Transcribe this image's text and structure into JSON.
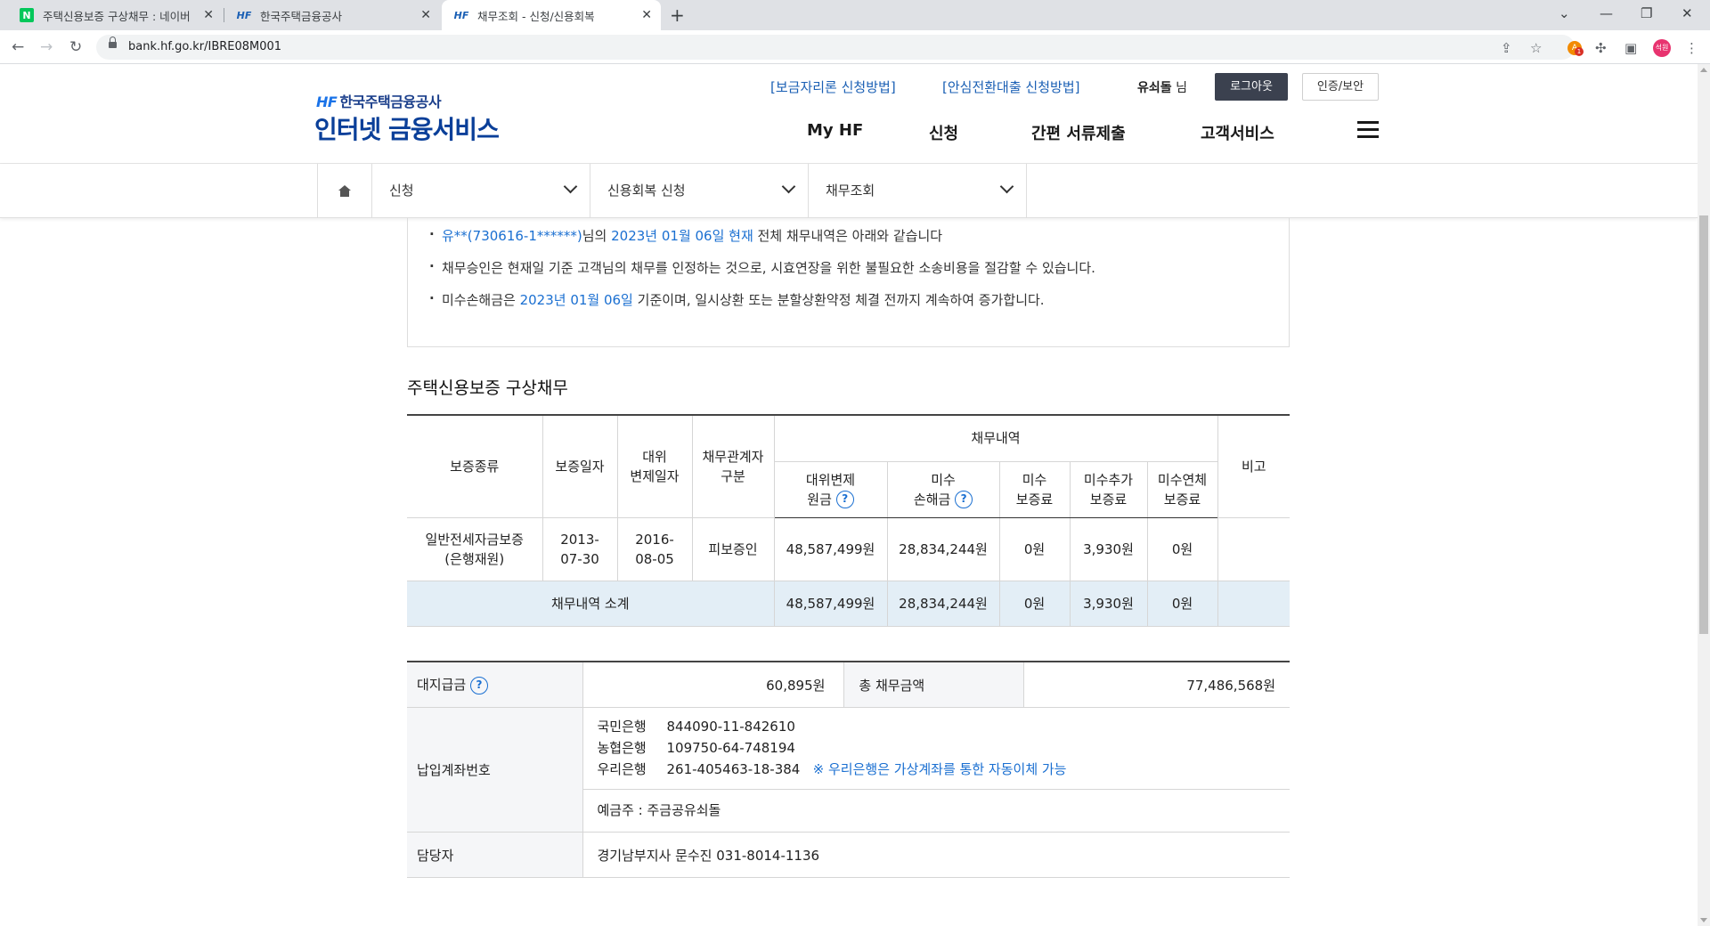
{
  "browser": {
    "tabs": [
      {
        "title": "주택신용보증 구상채무 : 네이버",
        "favicon": "naver-icon"
      },
      {
        "title": "한국주택금융공사",
        "favicon": "hf-icon"
      },
      {
        "title": "채무조회 - 신청/신용회복",
        "favicon": "hf-icon",
        "active": true
      }
    ],
    "url": "bank.hf.go.kr/IBRE08M001",
    "profile_initials": "석원",
    "extension_badge_count": "1"
  },
  "header": {
    "logo_small": "한국주택금융공사",
    "logo_hf": "HF",
    "logo_main": "인터넷 금융서비스",
    "top_links": [
      "[보금자리론 신청방법]",
      "[안심전환대출 신청방법]"
    ],
    "user_name": "유쇠돌",
    "user_suffix": "님",
    "logout_label": "로그아웃",
    "cert_label": "인증/보안",
    "gnb": [
      "My HF",
      "신청",
      "간편 서류제출",
      "고객서비스"
    ]
  },
  "breadcrumb": {
    "items": [
      "신청",
      "신용회복 신청",
      "채무조회"
    ]
  },
  "notice": {
    "line1": {
      "name": "유**(730616-1******)",
      "mid": "님의 ",
      "date": "2023년 01월 06일 현재",
      "rest": " 전체 채무내역은 아래와 같습니다"
    },
    "line2": "채무승인은 현재일 기준 고객님의 채무를 인정하는 것으로, 시효연장을 위한 불필요한 소송비용을 절감할 수 있습니다.",
    "line3": {
      "pre": "미수손해금은 ",
      "date": "2023년 01월 06일",
      "rest": " 기준이며, 일시상환 또는 분할상환약정 체결 전까지 계속하여 증가합니다."
    }
  },
  "section_title": "주택신용보증 구상채무",
  "debt_table": {
    "headers": {
      "type": "보증종류",
      "guarantee_date": "보증일자",
      "sub_date_1": "대위",
      "sub_date_2": "변제일자",
      "relation_1": "채무관계자",
      "relation_2": "구분",
      "group": "채무내역",
      "principal_1": "대위변제",
      "principal_2": "원금",
      "damages_1": "미수",
      "damages_2": "손해금",
      "fee_1": "미수",
      "fee_2": "보증료",
      "addfee_1": "미수추가",
      "addfee_2": "보증료",
      "latefee_1": "미수연체",
      "latefee_2": "보증료",
      "note": "비고"
    },
    "row": {
      "type_1": "일반전세자금보증",
      "type_2": "(은행재원)",
      "guarantee_date_1": "2013-",
      "guarantee_date_2": "07-30",
      "sub_date_1": "2016-",
      "sub_date_2": "08-05",
      "relation": "피보증인",
      "principal": "48,587,499원",
      "damages": "28,834,244원",
      "fee": "0원",
      "addfee": "3,930원",
      "latefee": "0원",
      "note": ""
    },
    "subtotal": {
      "label": "채무내역 소계",
      "principal": "48,587,499원",
      "damages": "28,834,244원",
      "fee": "0원",
      "addfee": "3,930원",
      "latefee": "0원",
      "note": ""
    }
  },
  "summary_table": {
    "advance_label": "대지급금",
    "advance_value": "60,895원",
    "total_label": "총 채무금액",
    "total_value": "77,486,568원",
    "account_label": "납입계좌번호",
    "accounts": [
      {
        "bank": "국민은행",
        "number": "844090-11-842610"
      },
      {
        "bank": "농협은행",
        "number": "109750-64-748194"
      },
      {
        "bank": "우리은행",
        "number": "261-405463-18-384",
        "note": "※ 우리은행은 가상계좌를 통한 자동이체 가능"
      }
    ],
    "holder": "예금주 : 주금공유쇠돌",
    "manager_label": "담당자",
    "manager_value": "경기남부지사 문수진 031-8014-1136"
  },
  "colors": {
    "brand_blue": "#0a3f99",
    "link_blue": "#1a6fd1",
    "subtotal_bg": "#e3eef6",
    "logout_bg": "#3b414f"
  }
}
